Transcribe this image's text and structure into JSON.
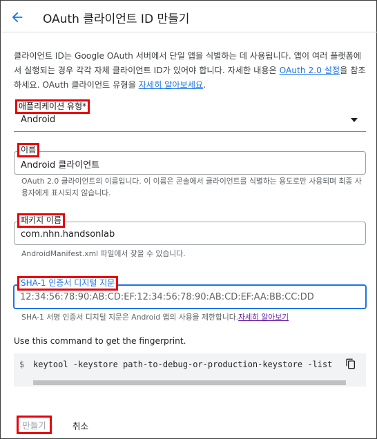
{
  "header": {
    "title": "OAuth 클라이언트 ID 만들기",
    "back_icon": "arrow-left-icon"
  },
  "description": {
    "text_before": "클라이언트 ID는 Google OAuth 서버에서 단일 앱을 식별하는 데 사용됩니다. 앱이 여러 플랫폼에서 실행되는 경우 각각 자체 클라이언트 ID가 있어야 합니다. 자세한 내용은 ",
    "link_oauth": "OAuth 2.0 설정",
    "text_middle": "을 참조하세요. OAuth 클라이언트 유형을 ",
    "link_learn": "자세히 알아보세요",
    "text_after": "."
  },
  "app_type": {
    "label": "애플리케이션 유형",
    "required_mark": "*",
    "value": "Android"
  },
  "name": {
    "label": "이름",
    "value": "Android 클라이언트",
    "helper": "OAuth 2.0 클라이언트의 이름입니다. 이 이름은 콘솔에서 클라이언트를 식별하는 용도로만 사용되며 최종 사용자에게 표시되지 않습니다."
  },
  "package": {
    "label": "패키지 이름",
    "value": "com.nhn.handsonlab",
    "helper": "AndroidManifest.xml 파일에서 찾을 수 있습니다."
  },
  "sha1": {
    "label": "SHA-1 인증서 디지털 지문",
    "value": "12:34:56:78:90:AB:CD:EF:12:34:56:78:90:AB:CD:EF:AA:BB:CC:DD",
    "helper": "SHA-1 서명 인증서 디지털 지문은 Android 앱의 사용을 제한합니다.",
    "helper_link": "자세히 알아보기"
  },
  "command": {
    "intro": "Use this command to get the fingerprint.",
    "prompt": "$",
    "code": "keytool -keystore path-to-debug-or-production-keystore -list",
    "copy_icon": "copy-icon"
  },
  "actions": {
    "create": "만들기",
    "cancel": "취소"
  },
  "colors": {
    "accent": "#1a73e8",
    "highlight": "#e8000b",
    "visited_link": "#681da8"
  }
}
